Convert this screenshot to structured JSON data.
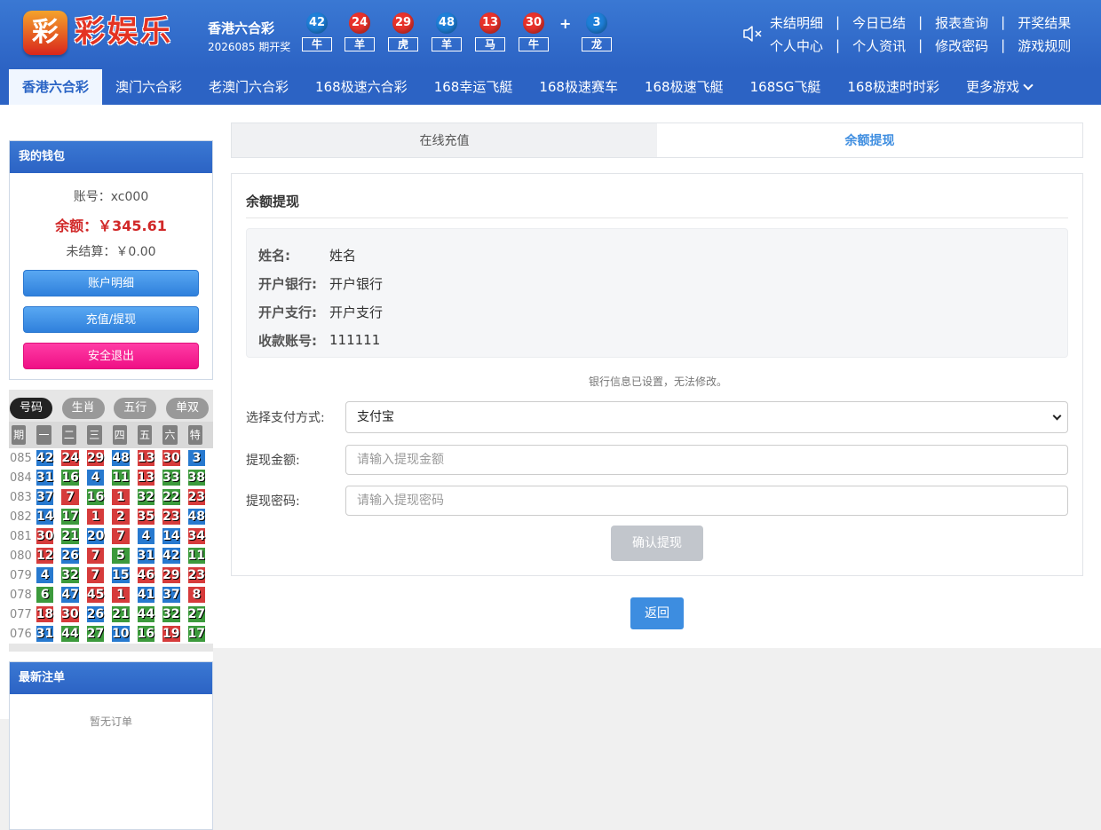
{
  "header": {
    "logo_glyph": "彩",
    "logo_text": "彩娱乐",
    "lottery_name": "香港六合彩",
    "issue": "2026085 期开奖",
    "balls": [
      {
        "num": "42",
        "color": "blue",
        "zodiac": "牛"
      },
      {
        "num": "24",
        "color": "red",
        "zodiac": "羊"
      },
      {
        "num": "29",
        "color": "red",
        "zodiac": "虎"
      },
      {
        "num": "48",
        "color": "blue",
        "zodiac": "羊"
      },
      {
        "num": "13",
        "color": "red",
        "zodiac": "马"
      },
      {
        "num": "30",
        "color": "red",
        "zodiac": "牛"
      },
      {
        "num": "3",
        "color": "blue",
        "zodiac": "龙"
      }
    ],
    "plus": "+",
    "mute_icon": "speaker-mute-icon",
    "links_row1": [
      "未结明细",
      "今日已结",
      "报表查询",
      "开奖结果"
    ],
    "links_row2": [
      "个人中心",
      "个人资讯",
      "修改密码",
      "游戏规则"
    ],
    "separator": "|"
  },
  "nav": {
    "tabs": [
      "香港六合彩",
      "澳门六合彩",
      "老澳门六合彩",
      "168极速六合彩",
      "168幸运飞艇",
      "168极速赛车",
      "168极速飞艇",
      "168SG飞艇",
      "168极速时时彩",
      "更多游戏"
    ],
    "active": 0
  },
  "wallet": {
    "title": "我的钱包",
    "account": "账号：xc000",
    "balance": "余额：￥345.61",
    "unsettled": "未结算：￥0.00",
    "btn_detail": "账户明细",
    "btn_recharge": "充值/提现",
    "btn_logout": "安全退出"
  },
  "history": {
    "tabs": [
      "号码",
      "生肖",
      "五行",
      "单双"
    ],
    "active_tab": 0,
    "headers": [
      "期",
      "一",
      "二",
      "三",
      "四",
      "五",
      "六",
      "特"
    ],
    "rows": [
      {
        "period": "085",
        "nums": [
          [
            "42",
            "blue"
          ],
          [
            "24",
            "red"
          ],
          [
            "29",
            "red"
          ],
          [
            "48",
            "blue"
          ],
          [
            "13",
            "red"
          ],
          [
            "30",
            "red"
          ],
          [
            "3",
            "blue"
          ]
        ]
      },
      {
        "period": "084",
        "nums": [
          [
            "31",
            "blue"
          ],
          [
            "16",
            "green"
          ],
          [
            "4",
            "blue"
          ],
          [
            "11",
            "green"
          ],
          [
            "13",
            "red"
          ],
          [
            "33",
            "green"
          ],
          [
            "38",
            "green"
          ]
        ]
      },
      {
        "period": "083",
        "nums": [
          [
            "37",
            "blue"
          ],
          [
            "7",
            "red"
          ],
          [
            "16",
            "green"
          ],
          [
            "1",
            "red"
          ],
          [
            "32",
            "green"
          ],
          [
            "22",
            "green"
          ],
          [
            "23",
            "red"
          ]
        ]
      },
      {
        "period": "082",
        "nums": [
          [
            "14",
            "blue"
          ],
          [
            "17",
            "green"
          ],
          [
            "1",
            "red"
          ],
          [
            "2",
            "red"
          ],
          [
            "35",
            "red"
          ],
          [
            "23",
            "red"
          ],
          [
            "48",
            "blue"
          ]
        ]
      },
      {
        "period": "081",
        "nums": [
          [
            "30",
            "red"
          ],
          [
            "21",
            "green"
          ],
          [
            "20",
            "blue"
          ],
          [
            "7",
            "red"
          ],
          [
            "4",
            "blue"
          ],
          [
            "14",
            "blue"
          ],
          [
            "34",
            "red"
          ]
        ]
      },
      {
        "period": "080",
        "nums": [
          [
            "12",
            "red"
          ],
          [
            "26",
            "blue"
          ],
          [
            "7",
            "red"
          ],
          [
            "5",
            "green"
          ],
          [
            "31",
            "blue"
          ],
          [
            "42",
            "blue"
          ],
          [
            "11",
            "green"
          ]
        ]
      },
      {
        "period": "079",
        "nums": [
          [
            "4",
            "blue"
          ],
          [
            "32",
            "green"
          ],
          [
            "7",
            "red"
          ],
          [
            "15",
            "blue"
          ],
          [
            "46",
            "red"
          ],
          [
            "29",
            "red"
          ],
          [
            "23",
            "red"
          ]
        ]
      },
      {
        "period": "078",
        "nums": [
          [
            "6",
            "green"
          ],
          [
            "47",
            "blue"
          ],
          [
            "45",
            "red"
          ],
          [
            "1",
            "red"
          ],
          [
            "41",
            "blue"
          ],
          [
            "37",
            "blue"
          ],
          [
            "8",
            "red"
          ]
        ]
      },
      {
        "period": "077",
        "nums": [
          [
            "18",
            "red"
          ],
          [
            "30",
            "red"
          ],
          [
            "26",
            "blue"
          ],
          [
            "21",
            "green"
          ],
          [
            "44",
            "green"
          ],
          [
            "32",
            "green"
          ],
          [
            "27",
            "green"
          ]
        ]
      },
      {
        "period": "076",
        "nums": [
          [
            "31",
            "blue"
          ],
          [
            "44",
            "green"
          ],
          [
            "27",
            "green"
          ],
          [
            "10",
            "blue"
          ],
          [
            "16",
            "green"
          ],
          [
            "19",
            "red"
          ],
          [
            "17",
            "green"
          ]
        ]
      }
    ]
  },
  "recent": {
    "title": "最新注单",
    "empty": "暂无订单"
  },
  "main": {
    "tab_recharge": "在线充值",
    "tab_withdraw": "余额提现",
    "card_title": "余额提现",
    "info": [
      {
        "k": "姓名:",
        "v": "姓名"
      },
      {
        "k": "开户银行:",
        "v": "开户银行"
      },
      {
        "k": "开户支行:",
        "v": "开户支行"
      },
      {
        "k": "收款账号:",
        "v": "111111"
      }
    ],
    "note": "银行信息已设置，无法修改。",
    "pay_label": "选择支付方式:",
    "pay_value": "支付宝",
    "amount_label": "提现金额:",
    "amount_placeholder": "请输入提现金额",
    "pwd_label": "提现密码:",
    "pwd_placeholder": "请输入提现密码",
    "confirm": "确认提现",
    "back": "返回"
  }
}
